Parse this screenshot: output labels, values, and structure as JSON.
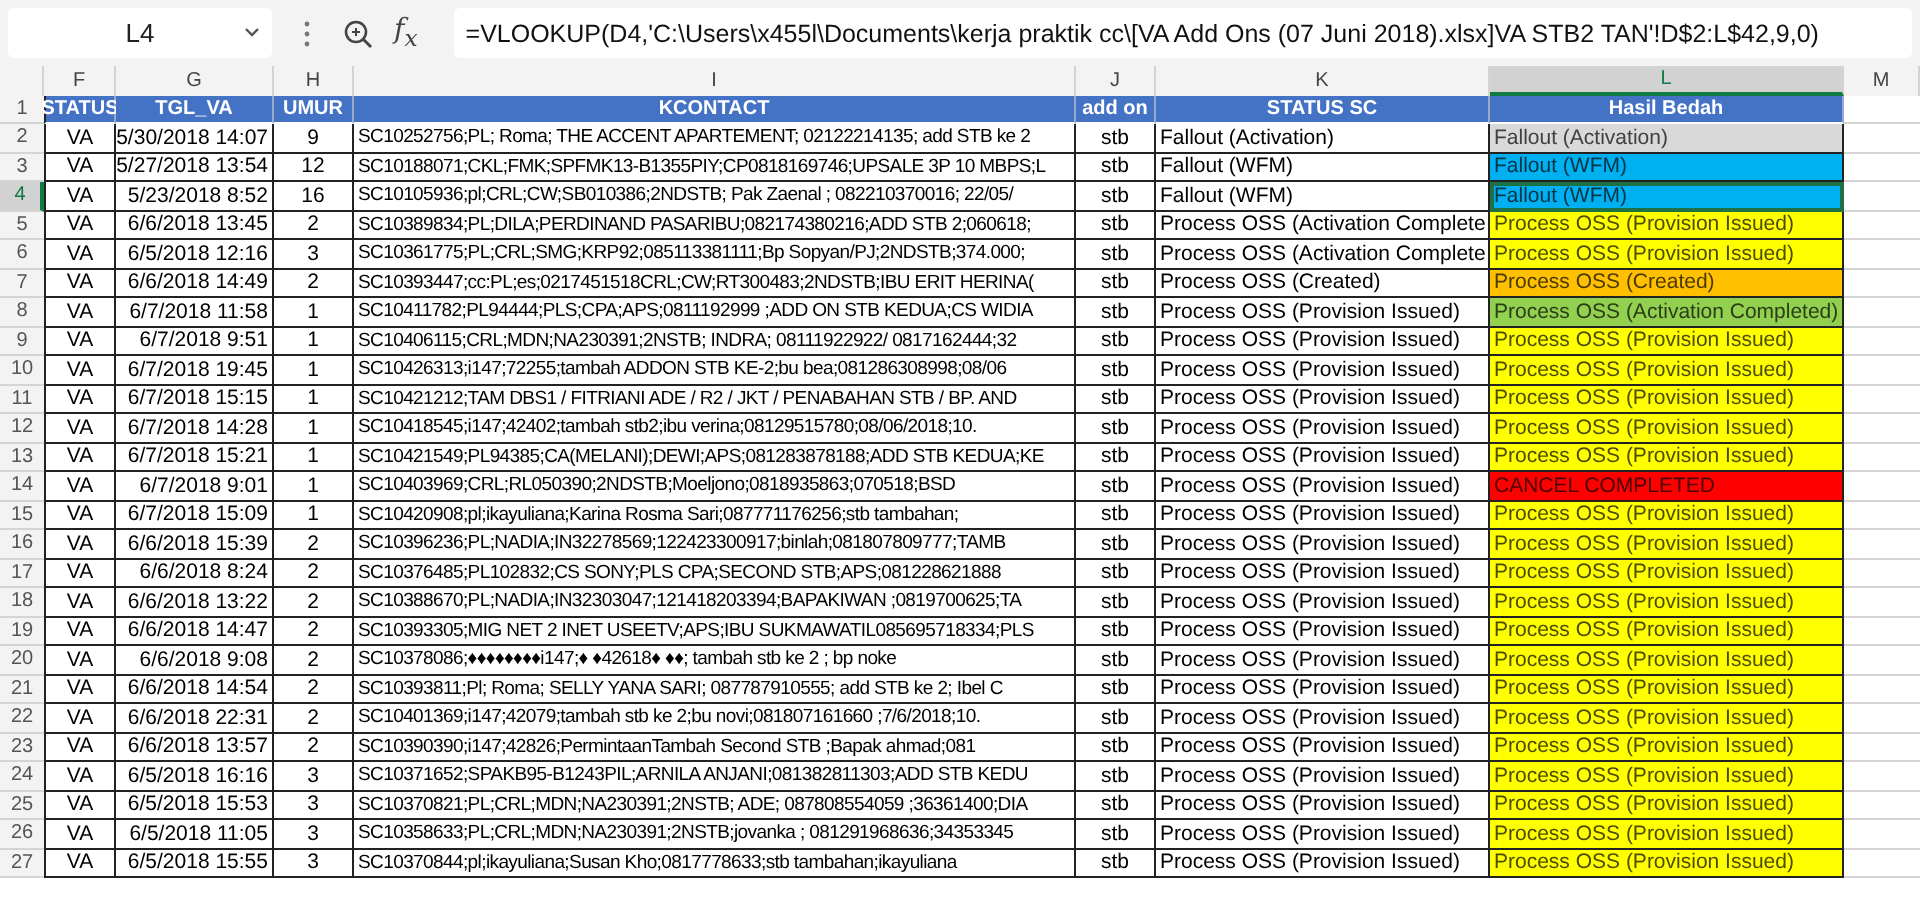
{
  "name_box": "L4",
  "function_label": "f$_{x}$",
  "formula": "=VLOOKUP(D4,'C:\\Users\\x455l\\Documents\\kerja praktik cc\\[VA Add Ons (07 Juni 2018).xlsx]VA STB2 TAN'!D$2:L$42,9,0)",
  "column_headers": [
    {
      "label": "F",
      "selected": false
    },
    {
      "label": "G",
      "selected": false
    },
    {
      "label": "H",
      "selected": false
    },
    {
      "label": "I",
      "selected": false
    },
    {
      "label": "J",
      "selected": false
    },
    {
      "label": "K",
      "selected": false
    },
    {
      "label": "L",
      "selected": true
    },
    {
      "label": "M",
      "selected": false
    }
  ],
  "table": {
    "header_row_number": "1",
    "columns": [
      "STATUS",
      "TGL_VA",
      "UMUR",
      "KCONTACT",
      "add on",
      "STATUS SC",
      "Hasil Bedah"
    ],
    "rows": [
      {
        "number": "2",
        "selected": false,
        "status": "VA",
        "tgl_va": "5/30/2018 14:07",
        "umur": "9",
        "kcontact": "SC10252756;PL; Roma; THE ACCENT APARTEMENT; 02122214135; add STB ke 2",
        "add_on": "stb",
        "status_sc": "Fallout (Activation)",
        "hasil_bedah": "Fallout (Activation)",
        "color": "#d9d9d9"
      },
      {
        "number": "3",
        "selected": false,
        "status": "VA",
        "tgl_va": "5/27/2018 13:54",
        "umur": "12",
        "kcontact": "SC10188071;CKL;FMK;SPFMK13-B1355PIY;CP0818169746;UPSALE 3P 10 MBPS;L",
        "add_on": "stb",
        "status_sc": "Fallout (WFM)",
        "hasil_bedah": "Fallout (WFM)",
        "color": "#00b0f0"
      },
      {
        "number": "4",
        "selected": true,
        "status": "VA",
        "tgl_va": "5/23/2018 8:52",
        "umur": "16",
        "kcontact": "SC10105936;pl;CRL;CW;SB010386;2NDSTB; Pak Zaenal ; 082210370016; 22/05/",
        "add_on": "stb",
        "status_sc": "Fallout (WFM)",
        "hasil_bedah": "Fallout (WFM)",
        "color": "#00b0f0"
      },
      {
        "number": "5",
        "selected": false,
        "status": "VA",
        "tgl_va": "6/6/2018 13:45",
        "umur": "2",
        "kcontact": "SC10389834;PL;DILA;PERDINAND PASARIBU;082174380216;ADD STB 2;060618;",
        "add_on": "stb",
        "status_sc": "Process OSS (Activation Complete",
        "hasil_bedah": "Process OSS (Provision Issued)",
        "color": "#ffff00"
      },
      {
        "number": "6",
        "selected": false,
        "status": "VA",
        "tgl_va": "6/5/2018 12:16",
        "umur": "3",
        "kcontact": "SC10361775;PL;CRL;SMG;KRP92;085113381111;Bp Sopyan/PJ;2NDSTB;374.000;",
        "add_on": "stb",
        "status_sc": "Process OSS (Activation Complete",
        "hasil_bedah": "Process OSS (Provision Issued)",
        "color": "#ffff00"
      },
      {
        "number": "7",
        "selected": false,
        "status": "VA",
        "tgl_va": "6/6/2018 14:49",
        "umur": "2",
        "kcontact": "SC10393447;cc:PL;es;0217451518CRL;CW;RT300483;2NDSTB;IBU ERIT HERINA(",
        "add_on": "stb",
        "status_sc": "Process OSS (Created)",
        "hasil_bedah": "Process OSS (Created)",
        "color": "#ffc000"
      },
      {
        "number": "8",
        "selected": false,
        "status": "VA",
        "tgl_va": "6/7/2018 11:58",
        "umur": "1",
        "kcontact": "SC10411782;PL94444;PLS;CPA;APS;0811192999 ;ADD ON STB KEDUA;CS WIDIA",
        "add_on": "stb",
        "status_sc": "Process OSS (Provision Issued)",
        "hasil_bedah": "Process OSS (Activation Completed)",
        "color": "#92d050"
      },
      {
        "number": "9",
        "selected": false,
        "status": "VA",
        "tgl_va": "6/7/2018 9:51",
        "umur": "1",
        "kcontact": "SC10406115;CRL;MDN;NA230391;2NSTB; INDRA; 08111922922/ 0817162444;32",
        "add_on": "stb",
        "status_sc": "Process OSS (Provision Issued)",
        "hasil_bedah": "Process OSS (Provision Issued)",
        "color": "#ffff00"
      },
      {
        "number": "10",
        "selected": false,
        "status": "VA",
        "tgl_va": "6/7/2018 19:45",
        "umur": "1",
        "kcontact": "SC10426313;i147;72255;tambah ADDON STB KE-2;bu bea;081286308998;08/06",
        "add_on": "stb",
        "status_sc": "Process OSS (Provision Issued)",
        "hasil_bedah": "Process OSS (Provision Issued)",
        "color": "#ffff00"
      },
      {
        "number": "11",
        "selected": false,
        "status": "VA",
        "tgl_va": "6/7/2018 15:15",
        "umur": "1",
        "kcontact": "SC10421212;TAM DBS1 / FITRIANI ADE / R2 / JKT / PENABAHAN STB / BP. AND",
        "add_on": "stb",
        "status_sc": "Process OSS (Provision Issued)",
        "hasil_bedah": "Process OSS (Provision Issued)",
        "color": "#ffff00"
      },
      {
        "number": "12",
        "selected": false,
        "status": "VA",
        "tgl_va": "6/7/2018 14:28",
        "umur": "1",
        "kcontact": "SC10418545;i147;42402;tambah stb2;ibu verina;08129515780;08/06/2018;10.",
        "add_on": "stb",
        "status_sc": "Process OSS (Provision Issued)",
        "hasil_bedah": "Process OSS (Provision Issued)",
        "color": "#ffff00"
      },
      {
        "number": "13",
        "selected": false,
        "status": "VA",
        "tgl_va": "6/7/2018 15:21",
        "umur": "1",
        "kcontact": "SC10421549;PL94385;CA(MELANI);DEWI;APS;081283878188;ADD STB KEDUA;KE",
        "add_on": "stb",
        "status_sc": "Process OSS (Provision Issued)",
        "hasil_bedah": "Process OSS (Provision Issued)",
        "color": "#ffff00"
      },
      {
        "number": "14",
        "selected": false,
        "status": "VA",
        "tgl_va": "6/7/2018 9:01",
        "umur": "1",
        "kcontact": "SC10403969;CRL;RL050390;2NDSTB;Moeljono;0818935863;070518;BSD",
        "add_on": "stb",
        "status_sc": "Process OSS (Provision Issued)",
        "hasil_bedah": "CANCEL COMPLETED",
        "color": "#ff0000"
      },
      {
        "number": "15",
        "selected": false,
        "status": "VA",
        "tgl_va": "6/7/2018 15:09",
        "umur": "1",
        "kcontact": "SC10420908;pl;ikayuliana;Karina Rosma Sari;087771176256;stb tambahan;",
        "add_on": "stb",
        "status_sc": "Process OSS (Provision Issued)",
        "hasil_bedah": "Process OSS (Provision Issued)",
        "color": "#ffff00"
      },
      {
        "number": "16",
        "selected": false,
        "status": "VA",
        "tgl_va": "6/6/2018 15:39",
        "umur": "2",
        "kcontact": "SC10396236;PL;NADIA;IN32278569;122423300917;binlah;081807809777;TAMB",
        "add_on": "stb",
        "status_sc": "Process OSS (Provision Issued)",
        "hasil_bedah": "Process OSS (Provision Issued)",
        "color": "#ffff00"
      },
      {
        "number": "17",
        "selected": false,
        "status": "VA",
        "tgl_va": "6/6/2018 8:24",
        "umur": "2",
        "kcontact": "SC10376485;PL102832;CS SONY;PLS CPA;SECOND STB;APS;081228621888",
        "add_on": "stb",
        "status_sc": "Process OSS (Provision Issued)",
        "hasil_bedah": "Process OSS (Provision Issued)",
        "color": "#ffff00"
      },
      {
        "number": "18",
        "selected": false,
        "status": "VA",
        "tgl_va": "6/6/2018 13:22",
        "umur": "2",
        "kcontact": "SC10388670;PL;NADIA;IN32303047;121418203394;BAPAKIWAN ;0819700625;TA",
        "add_on": "stb",
        "status_sc": "Process OSS (Provision Issued)",
        "hasil_bedah": "Process OSS (Provision Issued)",
        "color": "#ffff00"
      },
      {
        "number": "19",
        "selected": false,
        "status": "VA",
        "tgl_va": "6/6/2018 14:47",
        "umur": "2",
        "kcontact": "SC10393305;MIG NET 2 INET USEETV;APS;IBU SUKMAWATIL085695718334;PLS",
        "add_on": "stb",
        "status_sc": "Process OSS (Provision Issued)",
        "hasil_bedah": "Process OSS (Provision Issued)",
        "color": "#ffff00"
      },
      {
        "number": "20",
        "selected": false,
        "status": "VA",
        "tgl_va": "6/6/2018 9:08",
        "umur": "2",
        "kcontact": "SC10378086;♦♦♦♦♦♦♦♦i147;♦ ♦42618♦ ♦♦;  tambah stb ke 2 ; bp noke",
        "add_on": "stb",
        "status_sc": "Process OSS (Provision Issued)",
        "hasil_bedah": "Process OSS (Provision Issued)",
        "color": "#ffff00"
      },
      {
        "number": "21",
        "selected": false,
        "status": "VA",
        "tgl_va": "6/6/2018 14:54",
        "umur": "2",
        "kcontact": "SC10393811;Pl; Roma; SELLY YANA SARI; 087787910555;  add STB ke 2; Ibel C",
        "add_on": "stb",
        "status_sc": "Process OSS (Provision Issued)",
        "hasil_bedah": "Process OSS (Provision Issued)",
        "color": "#ffff00"
      },
      {
        "number": "22",
        "selected": false,
        "status": "VA",
        "tgl_va": "6/6/2018 22:31",
        "umur": "2",
        "kcontact": "SC10401369;i147;42079;tambah stb ke 2;bu novi;081807161660 ;7/6/2018;10.",
        "add_on": "stb",
        "status_sc": "Process OSS (Provision Issued)",
        "hasil_bedah": "Process OSS (Provision Issued)",
        "color": "#ffff00"
      },
      {
        "number": "23",
        "selected": false,
        "status": "VA",
        "tgl_va": "6/6/2018 13:57",
        "umur": "2",
        "kcontact": "SC10390390;i147;42826;PermintaanTambah Second STB ;Bapak ahmad;081",
        "add_on": "stb",
        "status_sc": "Process OSS (Provision Issued)",
        "hasil_bedah": "Process OSS (Provision Issued)",
        "color": "#ffff00"
      },
      {
        "number": "24",
        "selected": false,
        "status": "VA",
        "tgl_va": "6/5/2018 16:16",
        "umur": "3",
        "kcontact": "SC10371652;SPAKB95-B1243PIL;ARNILA ANJANI;081382811303;ADD STB KEDU",
        "add_on": "stb",
        "status_sc": "Process OSS (Provision Issued)",
        "hasil_bedah": "Process OSS (Provision Issued)",
        "color": "#ffff00"
      },
      {
        "number": "25",
        "selected": false,
        "status": "VA",
        "tgl_va": "6/5/2018 15:53",
        "umur": "3",
        "kcontact": "SC10370821;PL;CRL;MDN;NA230391;2NSTB; ADE; 087808554059 ;36361400;DIA",
        "add_on": "stb",
        "status_sc": "Process OSS (Provision Issued)",
        "hasil_bedah": "Process OSS (Provision Issued)",
        "color": "#ffff00"
      },
      {
        "number": "26",
        "selected": false,
        "status": "VA",
        "tgl_va": "6/5/2018 11:05",
        "umur": "3",
        "kcontact": "SC10358633;PL;CRL;MDN;NA230391;2NSTB;jovanka ; 081291968636;34353345",
        "add_on": "stb",
        "status_sc": "Process OSS (Provision Issued)",
        "hasil_bedah": "Process OSS (Provision Issued)",
        "color": "#ffff00"
      },
      {
        "number": "27",
        "selected": false,
        "status": "VA",
        "tgl_va": "6/5/2018 15:55",
        "umur": "3",
        "kcontact": "SC10370844;pl;ikayuliana;Susan Kho;0817778633;stb tambahan;ikayuliana",
        "add_on": "stb",
        "status_sc": "Process OSS (Provision Issued)",
        "hasil_bedah": "Process OSS (Provision Issued)",
        "color": "#ffff00"
      }
    ]
  }
}
